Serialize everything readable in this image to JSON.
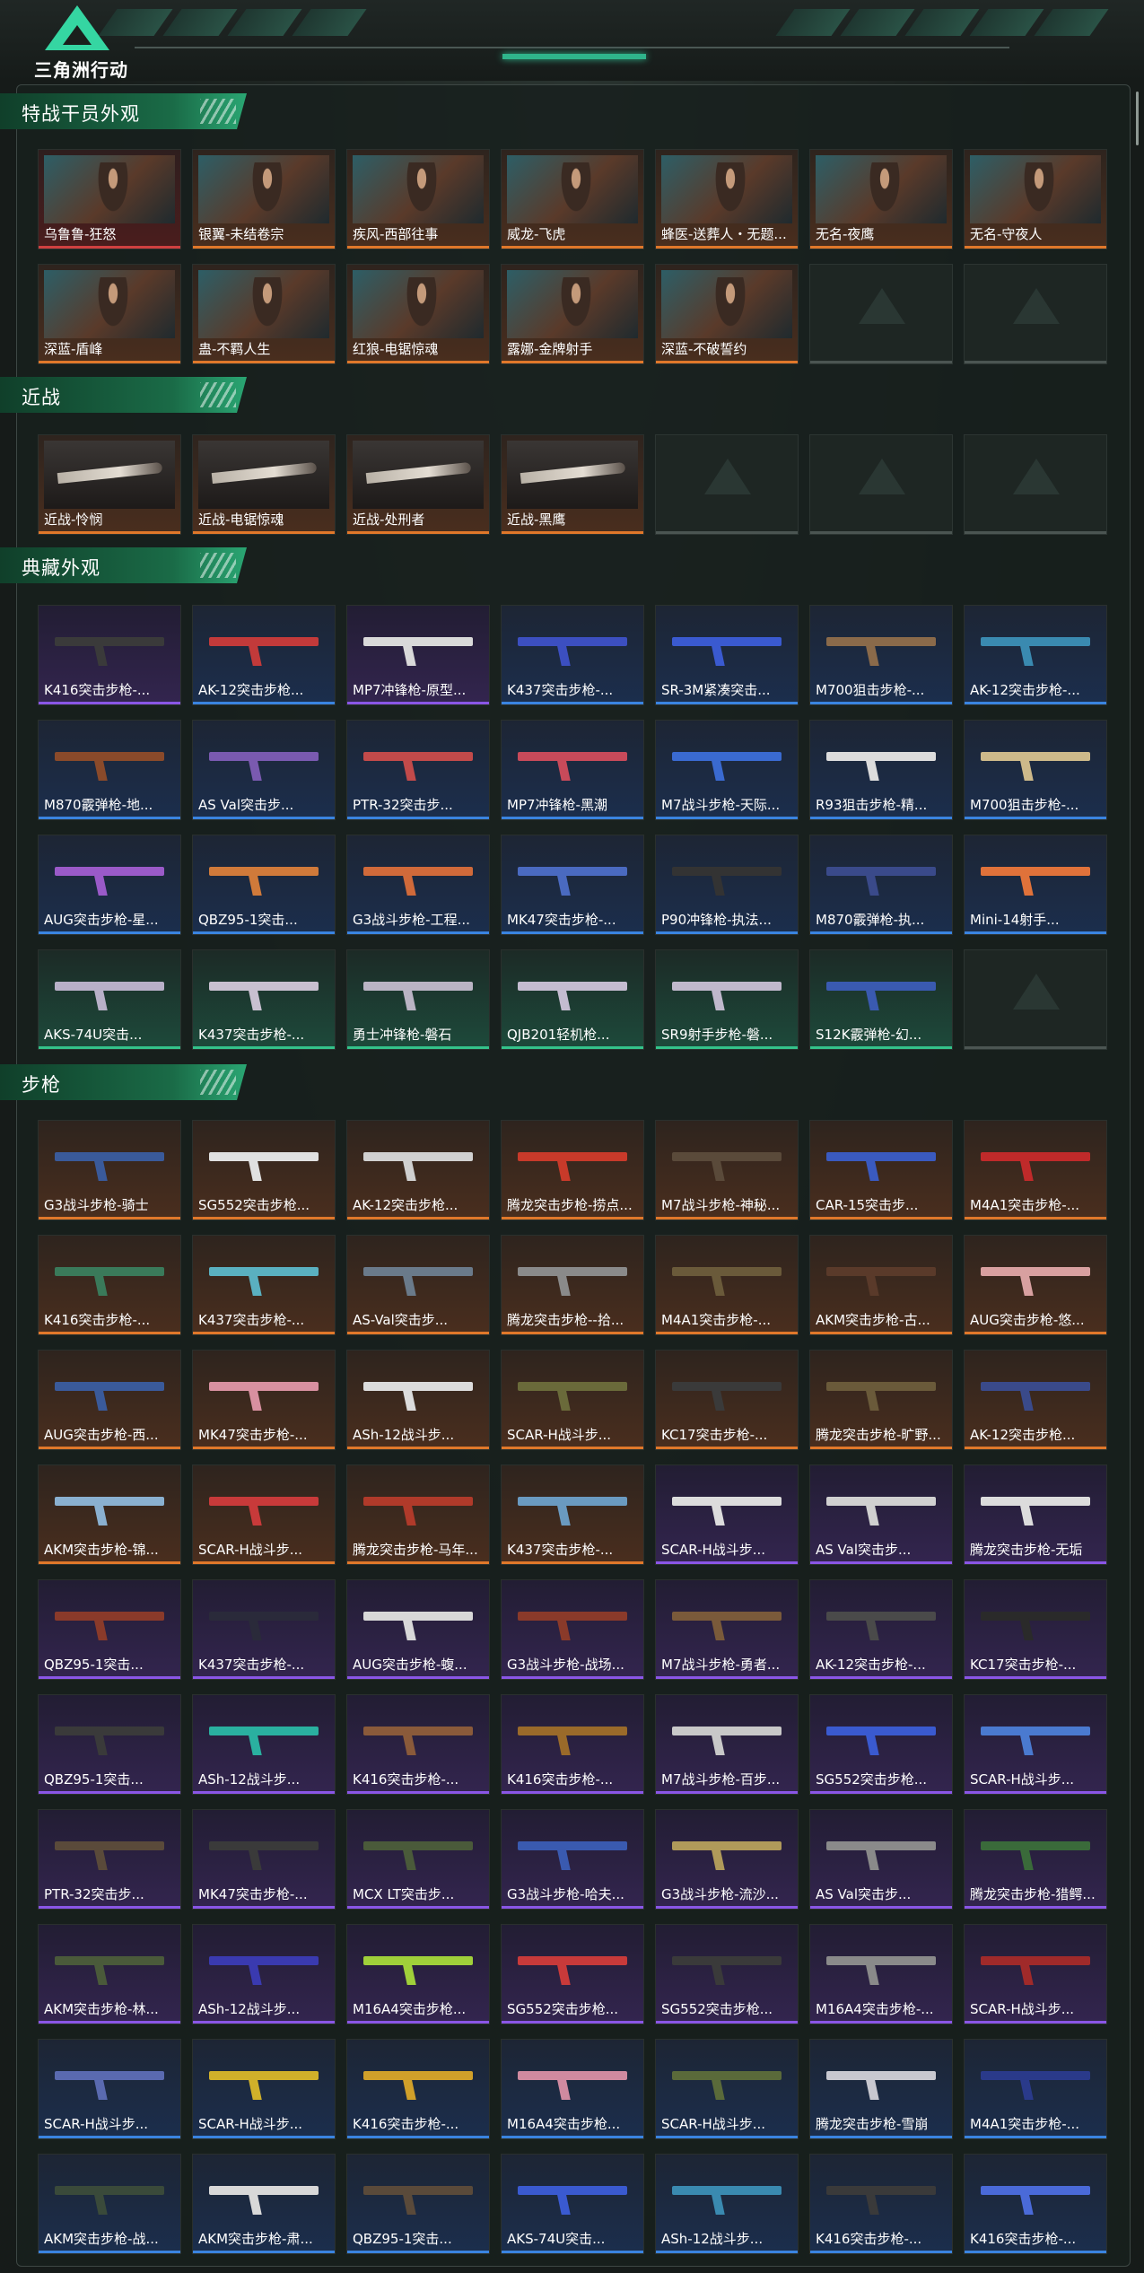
{
  "brand": "三角洲行动",
  "sections": [
    {
      "title": "特战干员外观",
      "items": [
        {
          "label": "乌鲁鲁-狂怒",
          "rarity": "red",
          "kind": "agent"
        },
        {
          "label": "银翼-未结卷宗",
          "rarity": "orange",
          "kind": "agent"
        },
        {
          "label": "疾风-西部往事",
          "rarity": "orange",
          "kind": "agent"
        },
        {
          "label": "威龙-飞虎",
          "rarity": "orange",
          "kind": "agent"
        },
        {
          "label": "蜂医-送葬人・无题...",
          "rarity": "orange",
          "kind": "agent"
        },
        {
          "label": "无名-夜鹰",
          "rarity": "orange",
          "kind": "agent"
        },
        {
          "label": "无名-守夜人",
          "rarity": "orange",
          "kind": "agent"
        },
        {
          "label": "深蓝-盾峰",
          "rarity": "orange",
          "kind": "agent"
        },
        {
          "label": "蛊-不羁人生",
          "rarity": "orange",
          "kind": "agent"
        },
        {
          "label": "红狼-电锯惊魂",
          "rarity": "orange",
          "kind": "agent"
        },
        {
          "label": "露娜-金牌射手",
          "rarity": "orange",
          "kind": "agent"
        },
        {
          "label": "深蓝-不破誓约",
          "rarity": "orange",
          "kind": "agent"
        },
        {
          "label": "",
          "rarity": "empty",
          "kind": "empty"
        },
        {
          "label": "",
          "rarity": "empty",
          "kind": "empty"
        }
      ]
    },
    {
      "title": "近战",
      "items": [
        {
          "label": "近战-怜悯",
          "rarity": "orange",
          "kind": "melee"
        },
        {
          "label": "近战-电锯惊魂",
          "rarity": "orange",
          "kind": "melee"
        },
        {
          "label": "近战-处刑者",
          "rarity": "orange",
          "kind": "melee"
        },
        {
          "label": "近战-黑鹰",
          "rarity": "orange",
          "kind": "melee"
        },
        {
          "label": "",
          "rarity": "empty",
          "kind": "empty"
        },
        {
          "label": "",
          "rarity": "empty",
          "kind": "empty"
        },
        {
          "label": "",
          "rarity": "empty",
          "kind": "empty"
        }
      ]
    },
    {
      "title": "典藏外观",
      "items": [
        {
          "label": "K416突击步枪-...",
          "rarity": "purple",
          "kind": "gun",
          "color": "#3a3a3a"
        },
        {
          "label": "AK-12突击步枪...",
          "rarity": "blue",
          "kind": "gun",
          "color": "#c23a3a"
        },
        {
          "label": "MP7冲锋枪-原型...",
          "rarity": "purple",
          "kind": "gun",
          "color": "#d9d9d9"
        },
        {
          "label": "K437突击步枪-...",
          "rarity": "blue",
          "kind": "gun",
          "color": "#3c4fc0"
        },
        {
          "label": "SR-3M紧凑突击...",
          "rarity": "blue",
          "kind": "gun",
          "color": "#3a5ad0"
        },
        {
          "label": "M700狙击步枪-...",
          "rarity": "blue",
          "kind": "gun",
          "color": "#8a6a4a"
        },
        {
          "label": "AK-12突击步枪-...",
          "rarity": "blue",
          "kind": "gun",
          "color": "#3a8ab0"
        },
        {
          "label": "M870霰弹枪-地...",
          "rarity": "blue",
          "kind": "gun",
          "color": "#8a4a2a"
        },
        {
          "label": "AS Val突击步...",
          "rarity": "blue",
          "kind": "gun",
          "color": "#7a5ab0"
        },
        {
          "label": "PTR-32突击步...",
          "rarity": "blue",
          "kind": "gun",
          "color": "#c24a4a"
        },
        {
          "label": "MP7冲锋枪-黑潮",
          "rarity": "blue",
          "kind": "gun",
          "color": "#c84a5a"
        },
        {
          "label": "M7战斗步枪-天际...",
          "rarity": "blue",
          "kind": "gun",
          "color": "#3a6ad0"
        },
        {
          "label": "R93狙击步枪-精...",
          "rarity": "blue",
          "kind": "gun",
          "color": "#dcdcdc"
        },
        {
          "label": "M700狙击步枪-...",
          "rarity": "blue",
          "kind": "gun",
          "color": "#cdb98a"
        },
        {
          "label": "AUG突击步枪-星...",
          "rarity": "blue",
          "kind": "gun",
          "color": "#9a5ac8"
        },
        {
          "label": "QBZ95-1突击...",
          "rarity": "blue",
          "kind": "gun",
          "color": "#d07a3a"
        },
        {
          "label": "G3战斗步枪-工程...",
          "rarity": "blue",
          "kind": "gun",
          "color": "#d06a3a"
        },
        {
          "label": "MK47突击步枪-...",
          "rarity": "blue",
          "kind": "gun",
          "color": "#4a6ac0"
        },
        {
          "label": "P90冲锋枪-执法...",
          "rarity": "blue",
          "kind": "gun",
          "color": "#333333"
        },
        {
          "label": "M870霰弹枪-执...",
          "rarity": "blue",
          "kind": "gun",
          "color": "#3a4a8a"
        },
        {
          "label": "Mini-14射手...",
          "rarity": "blue",
          "kind": "gun",
          "color": "#e0723a"
        },
        {
          "label": "AKS-74U突击...",
          "rarity": "green",
          "kind": "gun",
          "color": "#b8b0c8"
        },
        {
          "label": "K437突击步枪-...",
          "rarity": "green",
          "kind": "gun",
          "color": "#c8c0d0"
        },
        {
          "label": "勇士冲锋枪-磐石",
          "rarity": "green",
          "kind": "gun",
          "color": "#bab4c4"
        },
        {
          "label": "QJB201轻机枪...",
          "rarity": "green",
          "kind": "gun",
          "color": "#c4bcd0"
        },
        {
          "label": "SR9射手步枪-磐...",
          "rarity": "green",
          "kind": "gun",
          "color": "#c0b8cc"
        },
        {
          "label": "S12K霰弹枪-幻...",
          "rarity": "green",
          "kind": "gun",
          "color": "#3a5ab0"
        },
        {
          "label": "",
          "rarity": "empty",
          "kind": "empty"
        }
      ]
    },
    {
      "title": "步枪",
      "items": [
        {
          "label": "G3战斗步枪-骑士",
          "rarity": "orange",
          "kind": "gun",
          "color": "#3a5a9a"
        },
        {
          "label": "SG552突击步枪...",
          "rarity": "orange",
          "kind": "gun",
          "color": "#e0e0e0"
        },
        {
          "label": "AK-12突击步枪...",
          "rarity": "orange",
          "kind": "gun",
          "color": "#d0d0d0"
        },
        {
          "label": "腾龙突击步枪-捞点...",
          "rarity": "orange",
          "kind": "gun",
          "color": "#c83a2a"
        },
        {
          "label": "M7战斗步枪-神秘...",
          "rarity": "orange",
          "kind": "gun",
          "color": "#5a4a3a"
        },
        {
          "label": "CAR-15突击步...",
          "rarity": "orange",
          "kind": "gun",
          "color": "#3a5ac0"
        },
        {
          "label": "M4A1突击步枪-...",
          "rarity": "orange",
          "kind": "gun",
          "color": "#c02a2a"
        },
        {
          "label": "K416突击步枪-...",
          "rarity": "orange",
          "kind": "gun",
          "color": "#3a7a5a"
        },
        {
          "label": "K437突击步枪-...",
          "rarity": "orange",
          "kind": "gun",
          "color": "#5ab0c0"
        },
        {
          "label": "AS-Val突击步...",
          "rarity": "orange",
          "kind": "gun",
          "color": "#6a7a8a"
        },
        {
          "label": "腾龙突击步枪--拾...",
          "rarity": "orange",
          "kind": "gun",
          "color": "#8a8a8a"
        },
        {
          "label": "M4A1突击步枪-...",
          "rarity": "orange",
          "kind": "gun",
          "color": "#6a5a3a"
        },
        {
          "label": "AKM突击步枪-古...",
          "rarity": "orange",
          "kind": "gun",
          "color": "#5a3a2a"
        },
        {
          "label": "AUG突击步枪-悠...",
          "rarity": "orange",
          "kind": "gun",
          "color": "#d8a0a0"
        },
        {
          "label": "AUG突击步枪-西...",
          "rarity": "orange",
          "kind": "gun",
          "color": "#3a5a9a"
        },
        {
          "label": "MK47突击步枪-...",
          "rarity": "orange",
          "kind": "gun",
          "color": "#d890a0"
        },
        {
          "label": "ASh-12战斗步...",
          "rarity": "orange",
          "kind": "gun",
          "color": "#dcdcdc"
        },
        {
          "label": "SCAR-H战斗步...",
          "rarity": "orange",
          "kind": "gun",
          "color": "#6a6a3a"
        },
        {
          "label": "KC17突击步枪-...",
          "rarity": "orange",
          "kind": "gun",
          "color": "#3a3a3a"
        },
        {
          "label": "腾龙突击步枪-旷野...",
          "rarity": "orange",
          "kind": "gun",
          "color": "#6a5a3a"
        },
        {
          "label": "AK-12突击步枪...",
          "rarity": "orange",
          "kind": "gun",
          "color": "#3a4a8a"
        },
        {
          "label": "AKM突击步枪-锦...",
          "rarity": "orange",
          "kind": "gun",
          "color": "#8ab0d0"
        },
        {
          "label": "SCAR-H战斗步...",
          "rarity": "orange",
          "kind": "gun",
          "color": "#c83a3a"
        },
        {
          "label": "腾龙突击步枪-马年...",
          "rarity": "orange",
          "kind": "gun",
          "color": "#b03a2a"
        },
        {
          "label": "K437突击步枪-...",
          "rarity": "orange",
          "kind": "gun",
          "color": "#6a9ac0"
        },
        {
          "label": "SCAR-H战斗步...",
          "rarity": "purple",
          "kind": "gun",
          "color": "#dcdcdc"
        },
        {
          "label": "AS Val突击步...",
          "rarity": "purple",
          "kind": "gun",
          "color": "#d0d0d0"
        },
        {
          "label": "腾龙突击步枪-无垢",
          "rarity": "purple",
          "kind": "gun",
          "color": "#dcdcdc"
        },
        {
          "label": "QBZ95-1突击...",
          "rarity": "purple",
          "kind": "gun",
          "color": "#8a3a2a"
        },
        {
          "label": "K437突击步枪-...",
          "rarity": "purple",
          "kind": "gun",
          "color": "#2a2a3a"
        },
        {
          "label": "AUG突击步枪-蝮...",
          "rarity": "purple",
          "kind": "gun",
          "color": "#d8d8d8"
        },
        {
          "label": "G3战斗步枪-战场...",
          "rarity": "purple",
          "kind": "gun",
          "color": "#8a3a2a"
        },
        {
          "label": "M7战斗步枪-勇者...",
          "rarity": "purple",
          "kind": "gun",
          "color": "#7a5a3a"
        },
        {
          "label": "AK-12突击步枪-...",
          "rarity": "purple",
          "kind": "gun",
          "color": "#4a4a4a"
        },
        {
          "label": "KC17突击步枪-...",
          "rarity": "purple",
          "kind": "gun",
          "color": "#2a2a2a"
        },
        {
          "label": "QBZ95-1突击...",
          "rarity": "purple",
          "kind": "gun",
          "color": "#3a3a3a"
        },
        {
          "label": "ASh-12战斗步...",
          "rarity": "purple",
          "kind": "gun",
          "color": "#2ab0a0"
        },
        {
          "label": "K416突击步枪-...",
          "rarity": "purple",
          "kind": "gun",
          "color": "#8a5a3a"
        },
        {
          "label": "K416突击步枪-...",
          "rarity": "purple",
          "kind": "gun",
          "color": "#9a6a2a"
        },
        {
          "label": "M7战斗步枪-百步...",
          "rarity": "purple",
          "kind": "gun",
          "color": "#c8c8c8"
        },
        {
          "label": "SG552突击步枪...",
          "rarity": "purple",
          "kind": "gun",
          "color": "#3a5ad0"
        },
        {
          "label": "SCAR-H战斗步...",
          "rarity": "purple",
          "kind": "gun",
          "color": "#4a7ad0"
        },
        {
          "label": "PTR-32突击步...",
          "rarity": "purple",
          "kind": "gun",
          "color": "#5a4a3a"
        },
        {
          "label": "MK47突击步枪-...",
          "rarity": "purple",
          "kind": "gun",
          "color": "#3a3a3a"
        },
        {
          "label": "MCX LT突击步...",
          "rarity": "purple",
          "kind": "gun",
          "color": "#4a5a3a"
        },
        {
          "label": "G3战斗步枪-哈夫...",
          "rarity": "purple",
          "kind": "gun",
          "color": "#3a5ab0"
        },
        {
          "label": "G3战斗步枪-流沙...",
          "rarity": "purple",
          "kind": "gun",
          "color": "#b09a5a"
        },
        {
          "label": "AS Val突击步...",
          "rarity": "purple",
          "kind": "gun",
          "color": "#8a8a8a"
        },
        {
          "label": "腾龙突击步枪-猎鳄...",
          "rarity": "purple",
          "kind": "gun",
          "color": "#3a6a3a"
        },
        {
          "label": "AKM突击步枪-林...",
          "rarity": "purple",
          "kind": "gun",
          "color": "#4a5a3a"
        },
        {
          "label": "ASh-12战斗步...",
          "rarity": "purple",
          "kind": "gun",
          "color": "#3a3ab0"
        },
        {
          "label": "M16A4突击步枪...",
          "rarity": "purple",
          "kind": "gun",
          "color": "#a0d03a"
        },
        {
          "label": "SG552突击步枪...",
          "rarity": "purple",
          "kind": "gun",
          "color": "#c83a3a"
        },
        {
          "label": "SG552突击步枪...",
          "rarity": "purple",
          "kind": "gun",
          "color": "#3a3a3a"
        },
        {
          "label": "M16A4突击步枪-...",
          "rarity": "purple",
          "kind": "gun",
          "color": "#8a8a8a"
        },
        {
          "label": "SCAR-H战斗步...",
          "rarity": "purple",
          "kind": "gun",
          "color": "#a02a2a"
        },
        {
          "label": "SCAR-H战斗步...",
          "rarity": "blue",
          "kind": "gun",
          "color": "#5a6ab0"
        },
        {
          "label": "SCAR-H战斗步...",
          "rarity": "blue",
          "kind": "gun",
          "color": "#d0b02a"
        },
        {
          "label": "K416突击步枪-...",
          "rarity": "blue",
          "kind": "gun",
          "color": "#d0a02a"
        },
        {
          "label": "M16A4突击步枪...",
          "rarity": "blue",
          "kind": "gun",
          "color": "#d08aa0"
        },
        {
          "label": "SCAR-H战斗步...",
          "rarity": "blue",
          "kind": "gun",
          "color": "#5a6a3a"
        },
        {
          "label": "腾龙突击步枪-雪崩",
          "rarity": "blue",
          "kind": "gun",
          "color": "#c8c8d0"
        },
        {
          "label": "M4A1突击步枪-...",
          "rarity": "blue",
          "kind": "gun",
          "color": "#2a3a8a"
        },
        {
          "label": "AKM突击步枪-战...",
          "rarity": "blue",
          "kind": "gun",
          "color": "#3a4a3a"
        },
        {
          "label": "AKM突击步枪-肃...",
          "rarity": "blue",
          "kind": "gun",
          "color": "#d8d8d8"
        },
        {
          "label": "QBZ95-1突击...",
          "rarity": "blue",
          "kind": "gun",
          "color": "#5a4a3a"
        },
        {
          "label": "AKS-74U突击...",
          "rarity": "blue",
          "kind": "gun",
          "color": "#3a5ad0"
        },
        {
          "label": "ASh-12战斗步...",
          "rarity": "blue",
          "kind": "gun",
          "color": "#3a8ab0"
        },
        {
          "label": "K416突击步枪-...",
          "rarity": "blue",
          "kind": "gun",
          "color": "#3a3a3a"
        },
        {
          "label": "K416突击步枪-...",
          "rarity": "blue",
          "kind": "gun",
          "color": "#4a6ad8"
        }
      ]
    }
  ]
}
